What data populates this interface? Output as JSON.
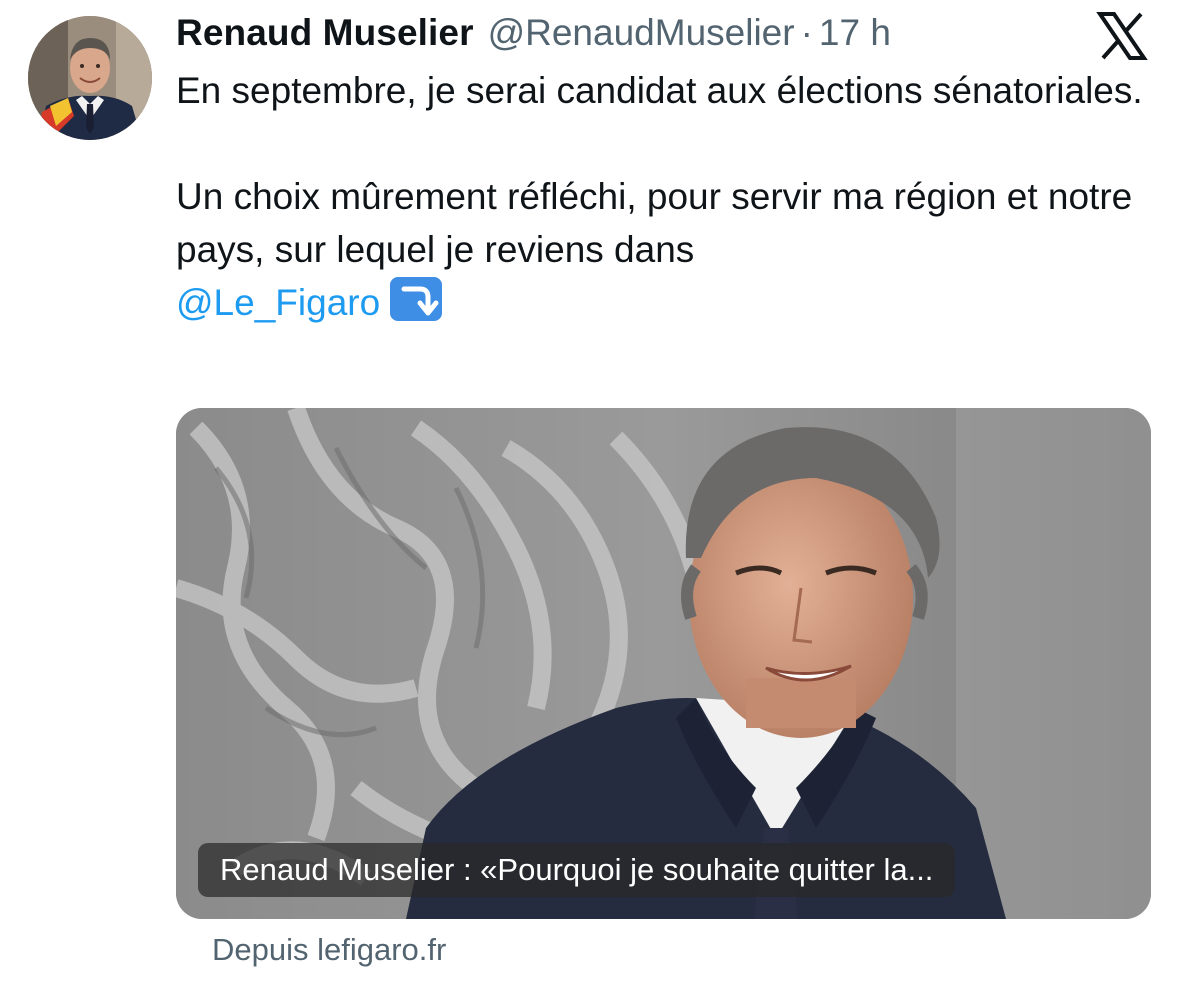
{
  "tweet": {
    "author": {
      "display_name": "Renaud Muselier",
      "handle": "@RenaudMuselier",
      "separator": "·",
      "time": "17 h",
      "avatar_icon": "profile-photo"
    },
    "platform_icon": "x-logo-icon",
    "text": {
      "paragraph1": "En septembre, je serai candidat aux élections sénatoriales.",
      "paragraph2": "Un choix mûrement réfléchi, pour servir ma région et notre pays, sur lequel je reviens dans",
      "mention": "@Le_Figaro",
      "emoji": "right-arrow-curving-down-emoji"
    },
    "link_card": {
      "image": "portrait-photo",
      "caption": "Renaud Muselier : «Pourquoi je souhaite quitter la...",
      "source_prefix": "Depuis",
      "source_domain": "lefigaro.fr"
    }
  },
  "colors": {
    "text_primary": "#0f1419",
    "text_secondary": "#536471",
    "link": "#1d9bf0",
    "emoji_bg": "#3e8ee6"
  }
}
